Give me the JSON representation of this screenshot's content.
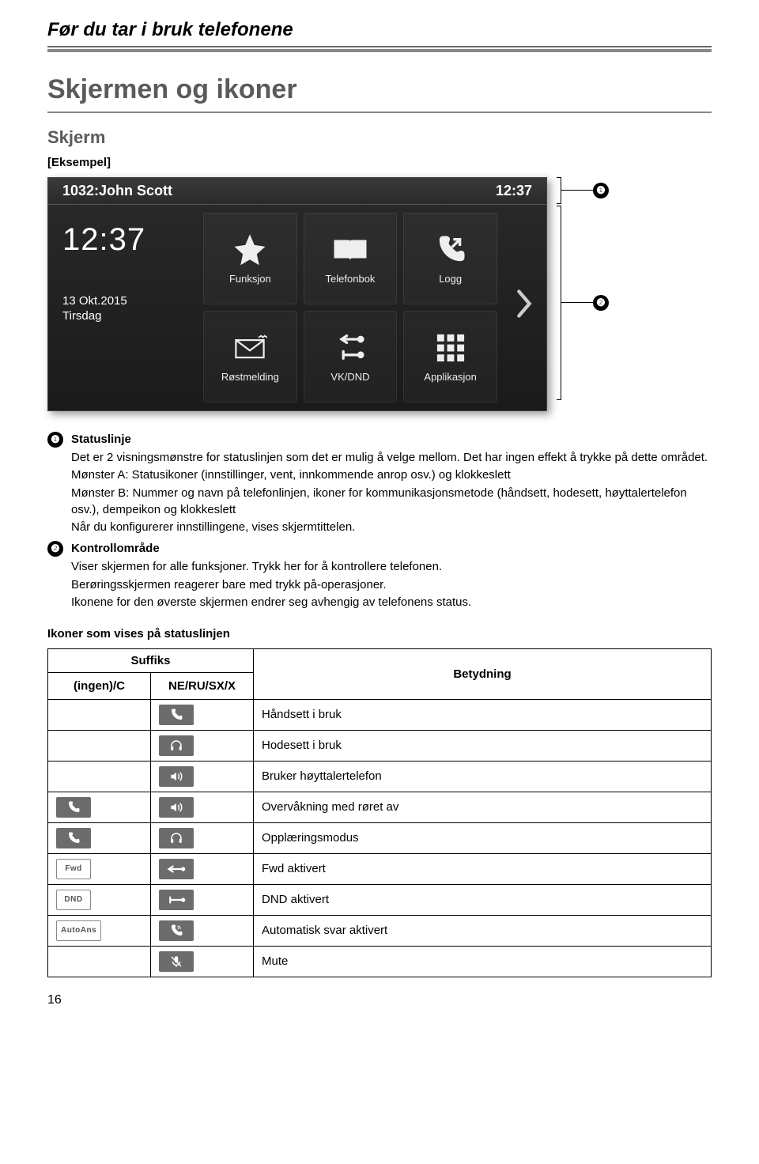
{
  "page_header": "Før du tar i bruk telefonene",
  "section_title": "Skjermen og ikoner",
  "subsection_title": "Skjerm",
  "example_label": "[Eksempel]",
  "screenshot": {
    "status_name": "1032:John Scott",
    "status_time": "12:37",
    "clock_time": "12:37",
    "date": "13 Okt.2015",
    "day": "Tirsdag",
    "tiles": [
      {
        "icon": "star-icon",
        "label": "Funksjon"
      },
      {
        "icon": "phonebook-icon",
        "label": "Telefonbok"
      },
      {
        "icon": "calllog-icon",
        "label": "Logg"
      },
      {
        "icon": "voicemail-icon",
        "label": "Røstmelding"
      },
      {
        "icon": "fwd-dnd-icon",
        "label": "VK/DND"
      },
      {
        "icon": "apps-icon",
        "label": "Applikasjon"
      }
    ],
    "callout_1": "❶",
    "callout_2": "❷"
  },
  "definitions": [
    {
      "num": "❶",
      "lead": "Statuslinje",
      "paras": [
        "Det er 2 visningsmønstre for statuslinjen som det er mulig å velge mellom. Det har ingen effekt å trykke på dette området.",
        "Mønster A: Statusikoner (innstillinger, vent, innkommende anrop osv.) og klokkeslett",
        "Mønster B: Nummer og navn på telefonlinjen, ikoner for kommunikasjonsmetode (håndsett, hodesett, høyttalertelefon osv.), dempeikon og klokkeslett",
        "Når du konfigurerer innstillingene, vises skjermtittelen."
      ]
    },
    {
      "num": "❷",
      "lead": "Kontrollområde",
      "paras": [
        "Viser skjermen for alle funksjoner. Trykk her for å kontrollere telefonen.",
        "Berøringsskjermen reagerer bare med trykk på-operasjoner.",
        "Ikonene for den øverste skjermen endrer seg avhengig av telefonens status."
      ]
    }
  ],
  "table_heading": "Ikoner som vises på statuslinjen",
  "table": {
    "col_suffix": "Suffiks",
    "col_ingen": "(ingen)/C",
    "col_ne": "NE/RU/SX/X",
    "col_meaning": "Betydning",
    "rows": [
      {
        "icons_a": [],
        "icons_b": [
          {
            "t": "solid",
            "g": "handset"
          }
        ],
        "meaning": "Håndsett i bruk"
      },
      {
        "icons_a": [],
        "icons_b": [
          {
            "t": "solid",
            "g": "headset"
          }
        ],
        "meaning": "Hodesett i bruk"
      },
      {
        "icons_a": [],
        "icons_b": [
          {
            "t": "solid",
            "g": "speaker"
          }
        ],
        "meaning": "Bruker høyttalertelefon"
      },
      {
        "icons_a": [
          {
            "t": "solid",
            "g": "handset"
          }
        ],
        "icons_b": [
          {
            "t": "solid",
            "g": "speaker"
          }
        ],
        "meaning": "Overvåkning med røret av"
      },
      {
        "icons_a": [
          {
            "t": "solid",
            "g": "handset"
          }
        ],
        "icons_b": [
          {
            "t": "solid",
            "g": "headset"
          }
        ],
        "meaning": "Opplæringsmodus"
      },
      {
        "icons_a": [
          {
            "t": "outline",
            "g": "Fwd"
          }
        ],
        "icons_b": [
          {
            "t": "solid",
            "g": "fwd"
          }
        ],
        "meaning": "Fwd aktivert"
      },
      {
        "icons_a": [
          {
            "t": "outline",
            "g": "DND"
          }
        ],
        "icons_b": [
          {
            "t": "solid",
            "g": "dnd"
          }
        ],
        "meaning": "DND aktivert"
      },
      {
        "icons_a": [
          {
            "t": "outline",
            "g": "AutoAns"
          }
        ],
        "icons_b": [
          {
            "t": "solid",
            "g": "autoans"
          }
        ],
        "meaning": "Automatisk svar aktivert"
      },
      {
        "icons_a": [],
        "icons_b": [
          {
            "t": "solid",
            "g": "mute"
          }
        ],
        "meaning": "Mute"
      }
    ]
  },
  "page_number": "16"
}
